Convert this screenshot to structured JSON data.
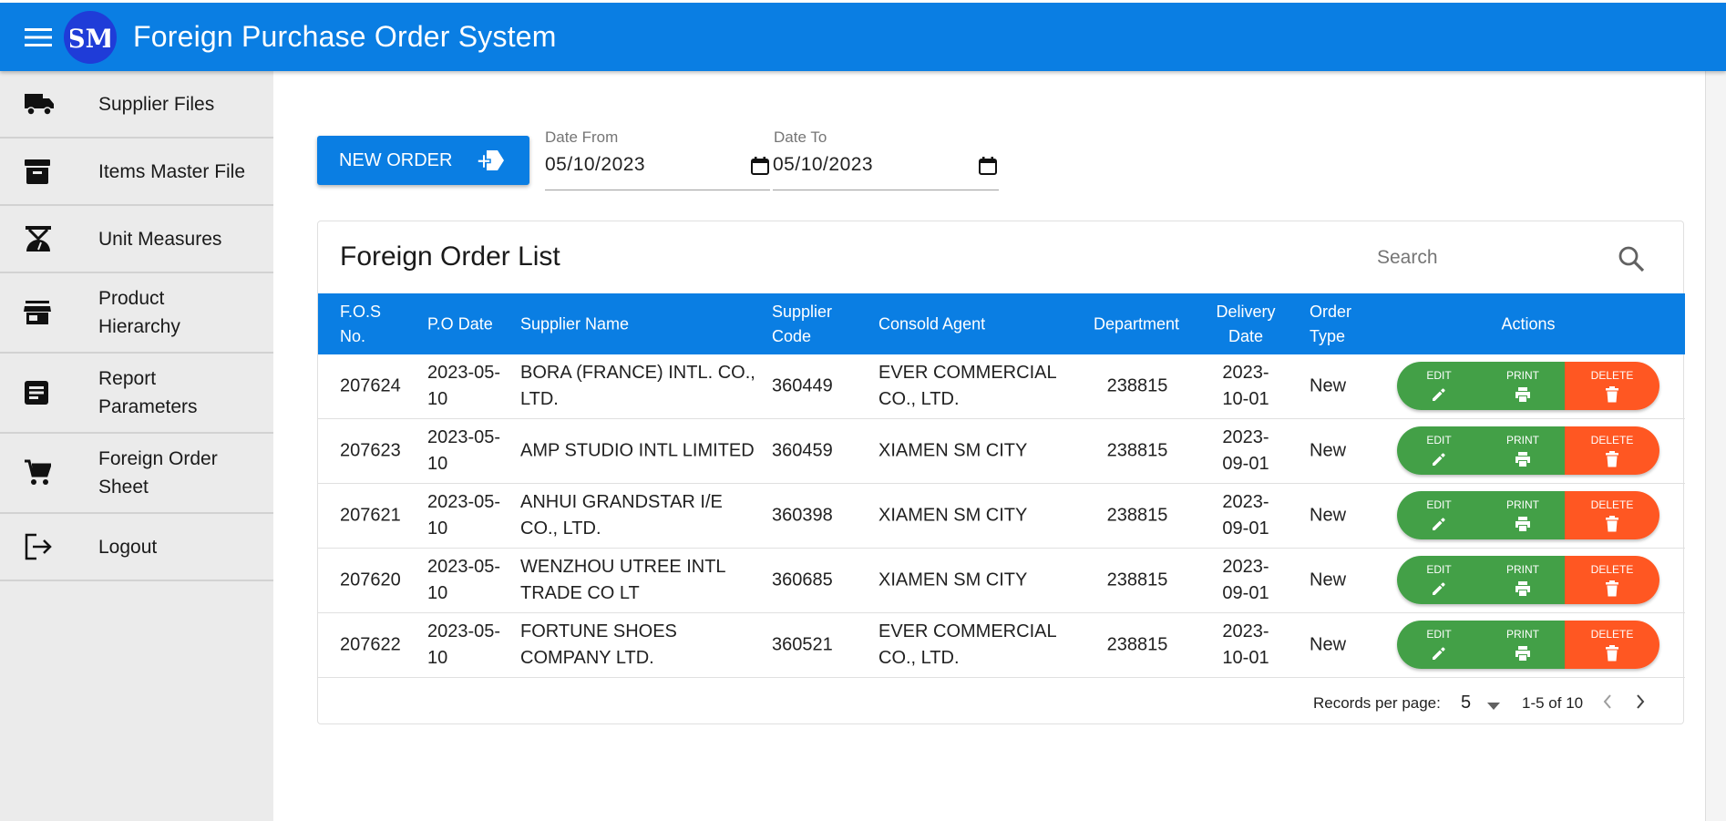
{
  "app": {
    "title": "Foreign Purchase Order System",
    "logo_text": "SM",
    "menu_icon": "menu-icon"
  },
  "sidebar": {
    "items": [
      {
        "label": "Supplier Files",
        "icon": "truck-icon"
      },
      {
        "label": "Items Master File",
        "icon": "archive-icon"
      },
      {
        "label": "Unit Measures",
        "icon": "scale-icon"
      },
      {
        "label": "Product Hierarchy",
        "icon": "store-icon"
      },
      {
        "label": "Report Parameters",
        "icon": "report-icon"
      },
      {
        "label": "Foreign Order Sheet",
        "icon": "cart-icon"
      },
      {
        "label": "Logout",
        "icon": "logout-icon"
      }
    ]
  },
  "toolbar": {
    "new_order_label": "NEW ORDER",
    "date_from_label": "Date From",
    "date_from_value": "05/10/2023",
    "date_to_label": "Date To",
    "date_to_value": "05/10/2023"
  },
  "list": {
    "title": "Foreign Order List",
    "search_placeholder": "Search",
    "columns": [
      "F.O.S No.",
      "P.O Date",
      "Supplier Name",
      "Supplier Code",
      "Consold Agent",
      "Department",
      "Delivery Date",
      "Order Type",
      "Actions"
    ],
    "action_labels": {
      "edit": "EDIT",
      "print": "PRINT",
      "delete": "DELETE"
    },
    "rows": [
      {
        "fos_no": "207624",
        "po_date": "2023-05-10",
        "supplier_name": "BORA (FRANCE) INTL. CO., LTD.",
        "supplier_code": "360449",
        "consold_agent": "EVER COMMERCIAL CO., LTD.",
        "department": "238815",
        "delivery_date": "2023-10-01",
        "order_type": "New"
      },
      {
        "fos_no": "207623",
        "po_date": "2023-05-10",
        "supplier_name": "AMP STUDIO INTL LIMITED",
        "supplier_code": "360459",
        "consold_agent": "XIAMEN SM CITY",
        "department": "238815",
        "delivery_date": "2023-09-01",
        "order_type": "New"
      },
      {
        "fos_no": "207621",
        "po_date": "2023-05-10",
        "supplier_name": "ANHUI GRANDSTAR I/E CO., LTD.",
        "supplier_code": "360398",
        "consold_agent": "XIAMEN SM CITY",
        "department": "238815",
        "delivery_date": "2023-09-01",
        "order_type": "New"
      },
      {
        "fos_no": "207620",
        "po_date": "2023-05-10",
        "supplier_name": "WENZHOU UTREE INTL TRADE CO LT",
        "supplier_code": "360685",
        "consold_agent": "XIAMEN SM CITY",
        "department": "238815",
        "delivery_date": "2023-09-01",
        "order_type": "New"
      },
      {
        "fos_no": "207622",
        "po_date": "2023-05-10",
        "supplier_name": "FORTUNE SHOES COMPANY LTD.",
        "supplier_code": "360521",
        "consold_agent": "EVER COMMERCIAL CO., LTD.",
        "department": "238815",
        "delivery_date": "2023-10-01",
        "order_type": "New"
      }
    ]
  },
  "pagination": {
    "label": "Records per page:",
    "per_page": "5",
    "range": "1-5 of 10"
  },
  "colors": {
    "primary": "#0a7ee3",
    "success": "#43a047",
    "danger": "#ff5722",
    "sidebar_bg": "#ebebeb"
  }
}
